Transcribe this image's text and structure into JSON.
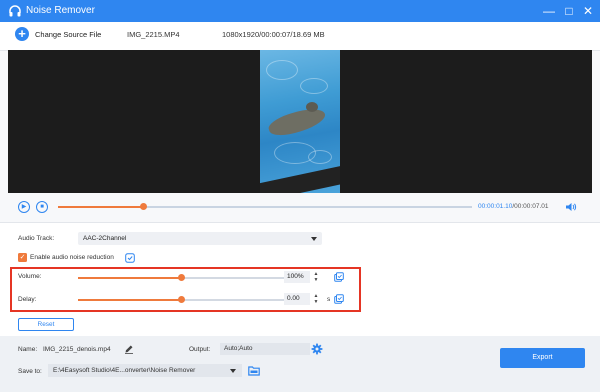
{
  "window": {
    "title": "Noise Remover"
  },
  "topbar": {
    "change_source_label": "Change Source File",
    "file_name": "IMG_2215.MP4",
    "file_meta": "1080x1920/00:00:07/18.69 MB"
  },
  "playback": {
    "current_time": "00:00:01.10",
    "total_time": "/00:00:07.01",
    "progress": 0.205
  },
  "settings": {
    "audio_track_label": "Audio Track:",
    "audio_track_value": "AAC-2Channel",
    "noise_reduction_label": "Enable audio noise reduction",
    "noise_reduction_checked": true,
    "volume_label": "Volume:",
    "volume_value": "100%",
    "volume_level": 0.5,
    "delay_label": "Delay:",
    "delay_value": "0.00",
    "delay_unit": "s",
    "delay_level": 0.5,
    "reset_label": "Reset"
  },
  "bottom": {
    "name_label": "Name:",
    "name_value": "IMG_2215_denois.mp4",
    "output_label": "Output:",
    "output_value": "Auto;Auto",
    "save_to_label": "Save to:",
    "save_to_value": "E:\\4Easysoft Studio\\4E...onverter\\Noise Remover",
    "export_label": "Export"
  },
  "colors": {
    "accent": "#2f86f0",
    "progress": "#ef7a3c",
    "highlight": "#e53524"
  },
  "icons": [
    "app-icon",
    "minimize-icon",
    "maximize-icon",
    "close-icon",
    "plus-icon",
    "play-icon",
    "stop-icon",
    "speaker-icon",
    "info-icon",
    "copy-icon",
    "edit-icon",
    "gear-icon",
    "folder-icon"
  ]
}
